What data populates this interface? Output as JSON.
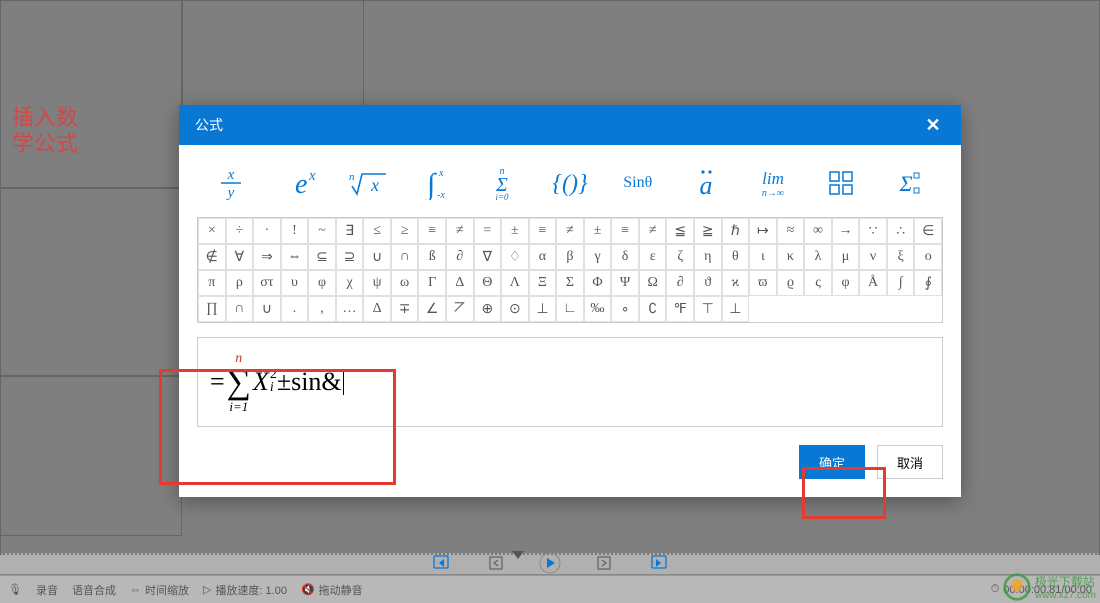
{
  "annotation_text": "插入数\n学公式",
  "modal": {
    "title": "公式",
    "templates": [
      "frac",
      "exp",
      "root",
      "integral",
      "sum",
      "braces",
      "sin",
      "umlaut",
      "lim",
      "matrix",
      "prodsum"
    ],
    "template_labels": {
      "sin": "Sinθ"
    },
    "symbols_rows": [
      [
        "×",
        "÷",
        "·",
        "!",
        "~",
        "∃",
        "≤",
        "≥",
        "≡",
        "≠",
        "=",
        "±",
        "≡",
        "≠",
        "±",
        "≡",
        "≠",
        "≦",
        "≧",
        "ℏ",
        "↦",
        "≈",
        "∞",
        "→",
        "∵",
        "∴"
      ],
      [
        "∈",
        "∉",
        "∀",
        "⇒",
        "⇔",
        "⊆",
        "⊇",
        "∪",
        "∩",
        "ß",
        "∂",
        "∇",
        "♢",
        "α",
        "β",
        "γ",
        "δ",
        "ε",
        "ζ",
        "η",
        "θ",
        "ι",
        "κ",
        "λ",
        "μ"
      ],
      [
        "ν",
        "ξ",
        "ο",
        "π",
        "ρ",
        "στ",
        "υ",
        "φ",
        "χ",
        "ψ",
        "ω",
        "Γ",
        "Δ",
        "Θ",
        "Λ",
        "Ξ",
        "Σ",
        "Φ",
        "Ψ",
        "Ω",
        "∂",
        "ϑ",
        "ϰ",
        "ϖ",
        "ϱ"
      ],
      [
        "ς",
        "φ",
        "Å",
        "∫",
        "∮",
        "∏",
        "∩",
        "∪",
        ".",
        ",",
        "…",
        "Δ",
        "∓",
        "∠",
        "⦢",
        "⊕",
        "⊙",
        "⊥",
        "∟",
        "‰",
        "∘",
        "∁",
        "℉",
        "⊤",
        "⊥"
      ]
    ],
    "formula": {
      "prefix": "=",
      "sum_upper": "n",
      "sum_lower": "i=1",
      "var": "X",
      "var_sup": "2",
      "var_sub": "i",
      "pm": "±",
      "tail": "sin&"
    },
    "ok_label": "确定",
    "cancel_label": "取消"
  },
  "bottom": {
    "rec": "录音",
    "tts": "语音合成",
    "timescale": "时间缩放",
    "speed": "播放速度: 1.00",
    "mute": "拖动静音",
    "time": "00:00:00.81/00:00"
  },
  "watermark": {
    "name": "极光下载站",
    "url": "www.xz7.com"
  }
}
